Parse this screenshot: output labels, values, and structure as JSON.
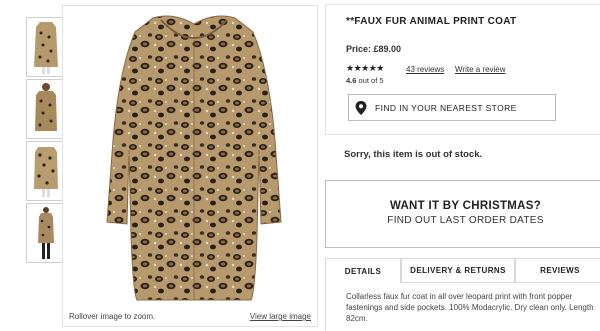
{
  "thumbnails": [
    {
      "alt": "thumbnail-1"
    },
    {
      "alt": "thumbnail-2"
    },
    {
      "alt": "thumbnail-3"
    },
    {
      "alt": "thumbnail-4"
    }
  ],
  "gallery": {
    "rollover_hint": "Rollover image to zoom.",
    "view_large": "View large image"
  },
  "product": {
    "title": "**FAUX FUR ANIMAL PRINT COAT",
    "price": "Price: £89.00",
    "stars": "★★★★★",
    "rating_value": "4.6",
    "rating_suffix": " out of 5",
    "reviews_link": "43 reviews",
    "write_review": "Write a review",
    "store_button": "FIND IN YOUR NEAREST STORE",
    "stock_message": "Sorry, this item is out of stock."
  },
  "christmas": {
    "title": "WANT IT BY CHRISTMAS?",
    "subtitle": "FIND OUT LAST ORDER DATES"
  },
  "tabs": [
    {
      "label": "DETAILS"
    },
    {
      "label": "DELIVERY & RETURNS"
    },
    {
      "label": "REVIEWS"
    }
  ],
  "details": {
    "description": "Collarless faux fur coat in all over leopard print with front popper fastenings and side pockets. 100% Modacrylic. Dry clean only. Length 82cm."
  },
  "colors": {
    "border": "#e2e2e2",
    "coat_base": "#b69a6e",
    "spot": "#2b2116"
  }
}
